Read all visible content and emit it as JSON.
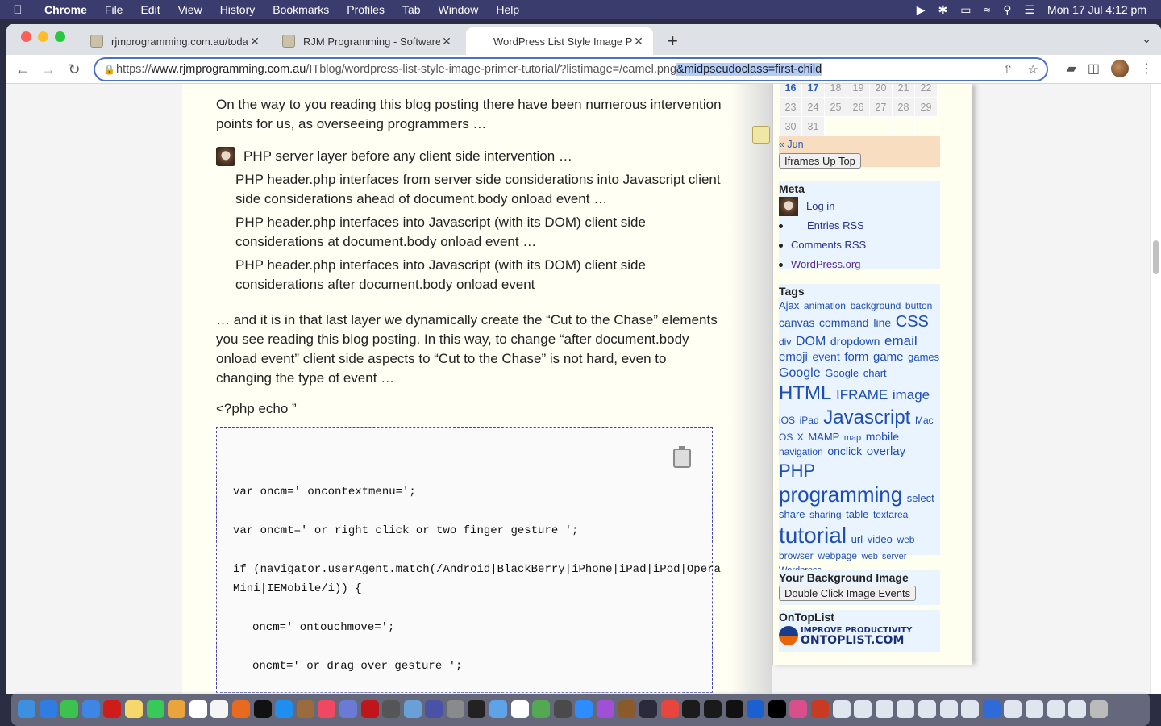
{
  "menubar": {
    "app": "Chrome",
    "items": [
      "File",
      "Edit",
      "View",
      "History",
      "Bookmarks",
      "Profiles",
      "Tab",
      "Window",
      "Help"
    ],
    "datetime": "Mon 17 Jul  4:12 pm"
  },
  "tabs": [
    {
      "title": "rjmprogramming.com.au/today",
      "active": false
    },
    {
      "title": "RJM Programming - Software I",
      "active": false
    },
    {
      "title": "WordPress List Style Image Pri",
      "active": true
    }
  ],
  "omnibox": {
    "url_prefix": "https://",
    "url_domain": "www.rjmprogramming.com.au",
    "url_path": "/ITblog/wordpress-list-style-image-primer-tutorial/?listimage=/camel.png",
    "url_selected": "&midpseudoclass=first-child"
  },
  "post": {
    "intro": "On the way to you reading this blog posting there have been numerous intervention points for us, as overseeing programmers …",
    "layer_head": "PHP server layer before any client side intervention …",
    "layer_items": [
      "PHP header.php interfaces from server side considerations into Javascript client side considerations ahead of document.body onload event …",
      "PHP header.php interfaces into Javascript (with its DOM) client side considerations at document.body onload event …",
      "PHP header.php interfaces into Javascript (with its DOM) client side considerations after document.body onload event"
    ],
    "body": "… and it is in that last layer we dynamically create the “Cut to the Chase” elements you see reading this blog posting. In this way, to change “after document.body onload event” client side aspects to “Cut to the Chase” is not hard, even to changing the type of event …",
    "code_intro": "<?php echo ”",
    "code_lines": [
      {
        "text": "var oncm=' oncontextmenu=';",
        "indent": false
      },
      {
        "text": "var oncmt=' or right click or two finger gesture ';",
        "indent": false
      },
      {
        "text": "if (navigator.userAgent.match(/Android|BlackBerry|iPhone|iPad|iPod|Opera\nMini|IEMobile/i)) {",
        "indent": false
      },
      {
        "text": "oncm=' ontouchmove=';",
        "indent": true
      },
      {
        "text": "oncmt=' or drag over gesture ';",
        "indent": true
      }
    ]
  },
  "calendar": {
    "rows": [
      [
        "16",
        "17",
        "18",
        "19",
        "20",
        "21",
        "22"
      ],
      [
        "23",
        "24",
        "25",
        "26",
        "27",
        "28",
        "29"
      ],
      [
        "30",
        "31",
        "",
        "",
        "",
        "",
        ""
      ]
    ],
    "today": [
      "16",
      "17"
    ],
    "prev_link": "« Jun",
    "button": "Iframes Up Top"
  },
  "meta": {
    "title": "Meta",
    "items": [
      "Log in",
      "Entries RSS",
      "Comments RSS",
      "WordPress.org"
    ]
  },
  "tags": {
    "title": "Tags",
    "items": [
      {
        "label": "Ajax",
        "size": 13
      },
      {
        "label": "animation",
        "size": 12
      },
      {
        "label": "background",
        "size": 12
      },
      {
        "label": "button",
        "size": 12
      },
      {
        "label": "canvas",
        "size": 14
      },
      {
        "label": "command line",
        "size": 14
      },
      {
        "label": "CSS",
        "size": 20
      },
      {
        "label": "div",
        "size": 12
      },
      {
        "label": "DOM",
        "size": 16
      },
      {
        "label": "dropdown",
        "size": 14
      },
      {
        "label": "email",
        "size": 17
      },
      {
        "label": "emoji",
        "size": 15
      },
      {
        "label": "event",
        "size": 14
      },
      {
        "label": "form",
        "size": 15
      },
      {
        "label": "game",
        "size": 15
      },
      {
        "label": "games",
        "size": 13
      },
      {
        "label": "Google",
        "size": 16
      },
      {
        "label": "Google chart",
        "size": 13
      },
      {
        "label": "HTML",
        "size": 24
      },
      {
        "label": "IFRAME",
        "size": 17
      },
      {
        "label": "image",
        "size": 17
      },
      {
        "label": "iOS",
        "size": 12
      },
      {
        "label": "iPad",
        "size": 12
      },
      {
        "label": "Javascript",
        "size": 24
      },
      {
        "label": "Mac OS X",
        "size": 12
      },
      {
        "label": "MAMP",
        "size": 13
      },
      {
        "label": "map",
        "size": 11
      },
      {
        "label": "mobile",
        "size": 14
      },
      {
        "label": "navigation",
        "size": 12
      },
      {
        "label": "onclick",
        "size": 14
      },
      {
        "label": "overlay",
        "size": 15
      },
      {
        "label": "PHP",
        "size": 22
      },
      {
        "label": "programming",
        "size": 26
      },
      {
        "label": "select",
        "size": 13
      },
      {
        "label": "share",
        "size": 13
      },
      {
        "label": "sharing",
        "size": 12
      },
      {
        "label": "table",
        "size": 13
      },
      {
        "label": "textarea",
        "size": 12
      },
      {
        "label": "tutorial",
        "size": 28
      },
      {
        "label": "url",
        "size": 13
      },
      {
        "label": "video",
        "size": 13
      },
      {
        "label": "web browser",
        "size": 12
      },
      {
        "label": "webpage",
        "size": 12
      },
      {
        "label": "web server",
        "size": 11
      },
      {
        "label": "Wordpress",
        "size": 11
      }
    ]
  },
  "background_widget": {
    "title": "Your Background Image",
    "button": "Double Click Image Events"
  },
  "ontoplist": {
    "title": "OnTopList",
    "logo_line1": "IMPROVE PRODUCTIVITY",
    "logo_line2": "ONTOPLIST.COM"
  },
  "colors": {
    "link": "#1e4db3",
    "omnibox_border": "#4a6fc4",
    "selection": "#b3cdf8",
    "sidebar_widget": "#eaf4ff"
  },
  "dock_icons": [
    "finder",
    "safari",
    "messages",
    "mail",
    "opera",
    "notes",
    "facetime",
    "photos",
    "calendar",
    "reminders",
    "firefox",
    "appletv",
    "appstore",
    "settings-like",
    "music",
    "launchpad",
    "filezilla",
    "calculator",
    "pencil",
    "bbedit",
    "system-prefs",
    "ghost",
    "preview",
    "textedit",
    "maps",
    "tool",
    "zoom",
    "podcasts",
    "book",
    "ide",
    "chrome",
    "quicktime",
    "inkscape",
    "terminal",
    "triangle",
    "terminal2",
    "apps",
    "compass",
    "folder1",
    "folder2",
    "folder3",
    "folder4",
    "folder5",
    "folder6",
    "folder7",
    "globe",
    "folder8",
    "folder9",
    "folder10",
    "folder11",
    "trash"
  ]
}
